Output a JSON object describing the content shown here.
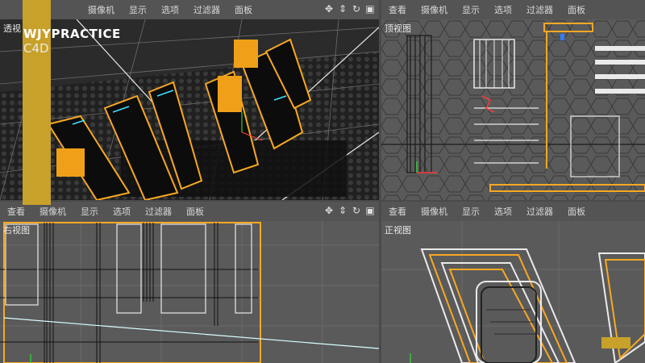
{
  "menu_labels": {
    "view": "查看",
    "camera": "摄像机",
    "display": "显示",
    "options": "选项",
    "filter": "过滤器",
    "panel": "面板"
  },
  "viewports": {
    "perspective": {
      "label": "透视"
    },
    "top": {
      "label": "顶视图"
    },
    "right": {
      "label": "右视图"
    },
    "front": {
      "label": "正视图"
    }
  },
  "brand": {
    "line1": "WJYPRACTICE",
    "line2": "C4D"
  },
  "icons": [
    "move-icon",
    "pan-icon",
    "rotate-icon",
    "maximize-icon"
  ],
  "colors": {
    "accent": "#f7a823",
    "bg": "#5b5b5b",
    "menubar": "#545454",
    "brand": "#c8a12a",
    "cyan": "#3fe0ff"
  }
}
